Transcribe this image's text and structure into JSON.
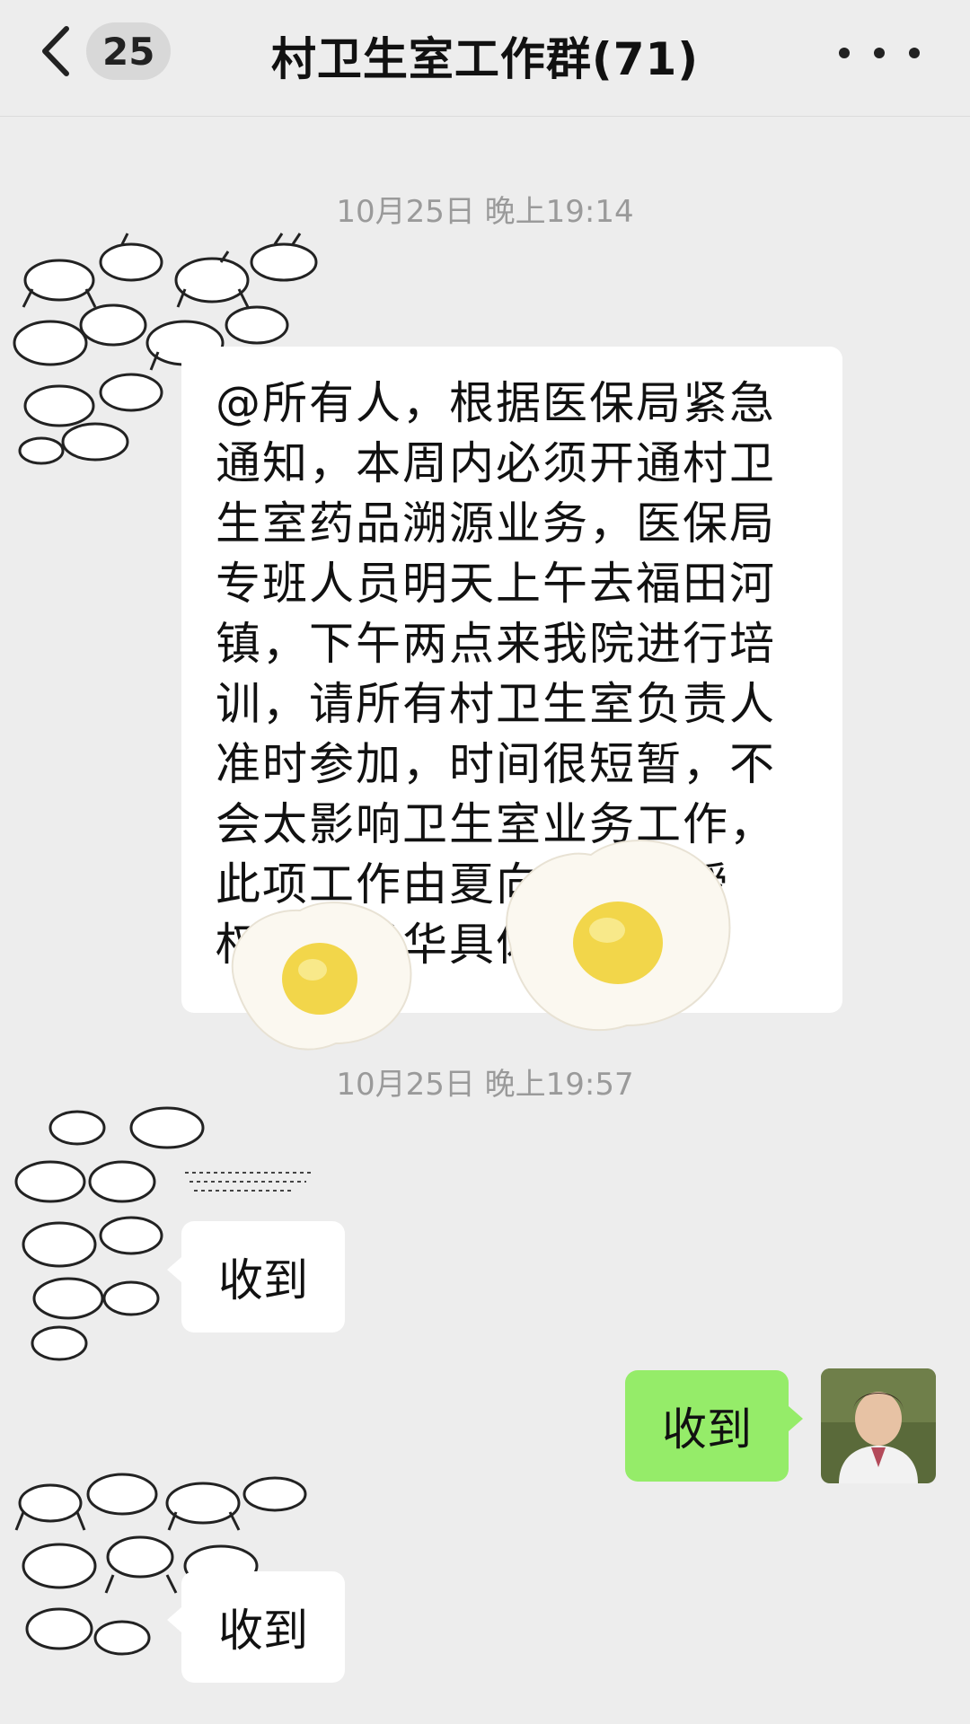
{
  "header": {
    "back_label": "",
    "unread_count": "25",
    "title": "村卫生室工作群(71)"
  },
  "messages": [
    {
      "time": "10月25日 晚上19:14"
    },
    {
      "text": "@所有人，根据医保局紧急通知，本周内必须开通村卫生室药品溯源业务，医保局专班人员明天上午去福田河镇，下午两点来我院进行培训，请所有村卫生室负责人准时参加，时间很短暂，不会太影响卫生室业务工作，此项工作由夏向宇负责授权、成杨华具体",
      "sender": "left"
    },
    {
      "time": "10月25日 晚上19:57"
    },
    {
      "text": "收到",
      "sender": "left"
    },
    {
      "text": "收到",
      "sender": "self"
    },
    {
      "text": "收到",
      "sender": "left"
    }
  ],
  "colors": {
    "background": "#ededed",
    "bubble_incoming": "#ffffff",
    "bubble_outgoing": "#95ec69",
    "timestamp": "#9a9a9a"
  },
  "icons": {
    "back": "chevron-left-icon",
    "more": "more-dots-icon"
  }
}
